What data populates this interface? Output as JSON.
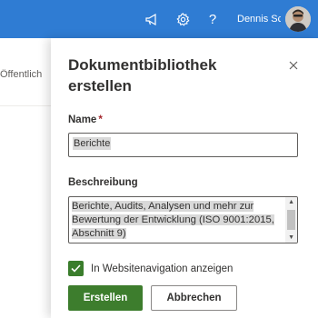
{
  "topbar": {
    "icons": [
      "megaphone-icon",
      "gear-icon",
      "help-icon"
    ],
    "help_glyph": "?",
    "user_name": "Dennis Scherrer | ...",
    "color": "#2f7cd3"
  },
  "background_page": {
    "partial_text": "Öffentlich"
  },
  "panel": {
    "title": "Dokumentbibliothek erstellen",
    "close_icon": "close-icon",
    "name_label": "Name",
    "required_marker": "*",
    "name_value": "Berichte",
    "description_label": "Beschreibung",
    "description_value": "Berichte, Audits, Analysen und mehr zur Bewertung der Entwicklung (ISO 9001:2015, Abschnitt 9)",
    "checkbox_label": "In Websitenavigation anzeigen",
    "checkbox_checked": true,
    "create_button": "Erstellen",
    "cancel_button": "Abbrechen",
    "accent_color": "#3d7d2d"
  }
}
